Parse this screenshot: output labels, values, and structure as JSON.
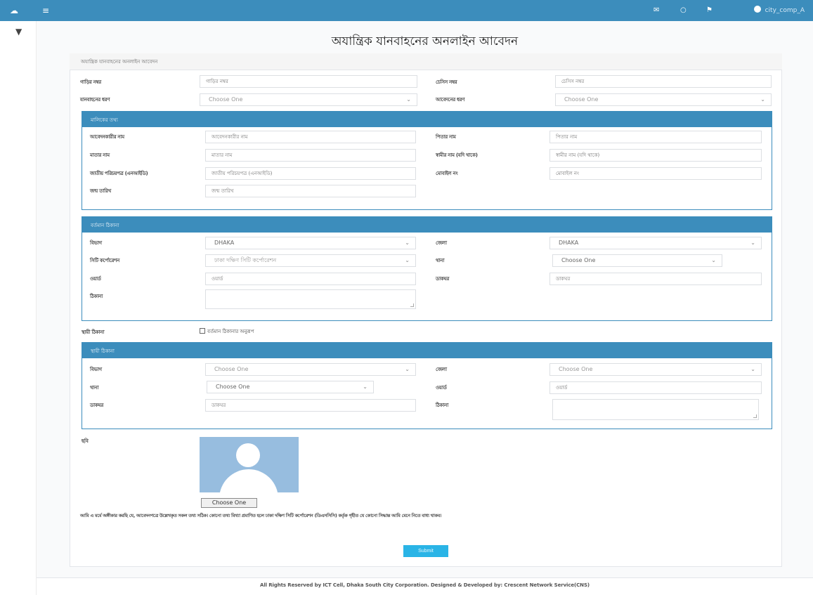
{
  "topbar": {
    "brand_icon": "home-icon",
    "menu_icon": "hamburger-menu-icon",
    "icons": [
      "mail-icon",
      "bell-icon",
      "flag-icon"
    ],
    "user_name": "city_comp_A"
  },
  "sidebar": {
    "icon": "dashboard-icon"
  },
  "page": {
    "title": "অযান্ত্রিক যানবাহনের অনলাইন আবেদন",
    "panel_heading": "অযান্ত্রিক যানবাহনের অনলাইন আবেদন"
  },
  "vehicle": {
    "reg_no_label": "গাড়ির নম্বর",
    "reg_no_placeholder": "গাড়ির নম্বর",
    "chassis_label": "চেসিস নম্বর",
    "chassis_placeholder": "চেসিস নম্বর",
    "type_label": "যানবাহনের ধরণ",
    "type_value": "Choose One",
    "app_type_label": "আবেদনের ধরণ",
    "app_type_value": "Choose One"
  },
  "owner": {
    "heading": "মালিকের তথ্য",
    "name_label": "আবেদনকারীর নাম",
    "name_placeholder": "আবেদনকারীর নাম",
    "father_label": "পিতার নাম",
    "father_placeholder": "পিতার নাম",
    "mother_label": "মাতার নাম",
    "mother_placeholder": "মাতার নাম",
    "spouse_label": "স্বামীর নাম (যদি থাকে)",
    "spouse_placeholder": "স্বামীর নাম (যদি থাকে)",
    "nid_label": "জাতীয় পরিচয়পত্র (এনআইডি)",
    "nid_placeholder": "জাতীয় পরিচয়পত্র (এনআইডি)",
    "mobile_label": "মোবাইল নং",
    "mobile_placeholder": "মোবাইল নং",
    "dob_label": "জন্ম তারিখ",
    "dob_placeholder": "জন্ম তারিখ"
  },
  "present_address": {
    "heading": "বর্তমান ঠিকানা",
    "division_label": "বিভাগ",
    "division_value": "DHAKA",
    "district_label": "জেলা",
    "district_value": "DHAKA",
    "city_label": "সিটি কর্পোরেশন",
    "city_value": "ঢাকা দক্ষিণ সিটি কর্পোরেশন",
    "thana_label": "থানা",
    "thana_value": "Choose One",
    "ward_label": "ওয়ার্ড",
    "ward_placeholder": "ওয়ার্ড",
    "postcode_label": "ডাকঘর",
    "postcode_placeholder": "ডাকঘর",
    "address_label": "ঠিকানা"
  },
  "permanent_toggle": {
    "label": "স্থায়ী ঠিকানা",
    "checkbox_label": "বর্তমান ঠিকানার অনুরূপ"
  },
  "permanent_address": {
    "heading": "স্থায়ী ঠিকানা",
    "division_label": "বিভাগ",
    "division_value": "Choose One",
    "district_label": "জেলা",
    "district_value": "Choose One",
    "thana_label": "থানা",
    "thana_value": "Choose One",
    "ward_label": "ওয়ার্ড",
    "ward_placeholder": "ওয়ার্ড",
    "postcode_label": "ডাকঘর",
    "postcode_placeholder": "ডাকঘর",
    "address_label": "ঠিকানা"
  },
  "photo": {
    "label": "ছবি",
    "choose_button": "Choose One"
  },
  "declaration": "আমি এ মর্মে অঙ্গীকার করছি যে, আবেদনপত্রে উল্লেখকৃত সকল তথ্য সঠিক। কোনো তথ্য মিথ্যা প্রমাণিত হলে ঢাকা দক্ষিণ সিটি কর্পোরেশন (ডিএসসিসি) কর্তৃক গৃহীত যে কোনো সিদ্ধান্ত আমি মেনে নিতে বাধ্য থাকব।",
  "submit_label": "Submit",
  "footer": "All Rights Reserved by ICT Cell, Dhaka South City Corporation. Designed & Developed by: Crescent Network Service(CNS)"
}
